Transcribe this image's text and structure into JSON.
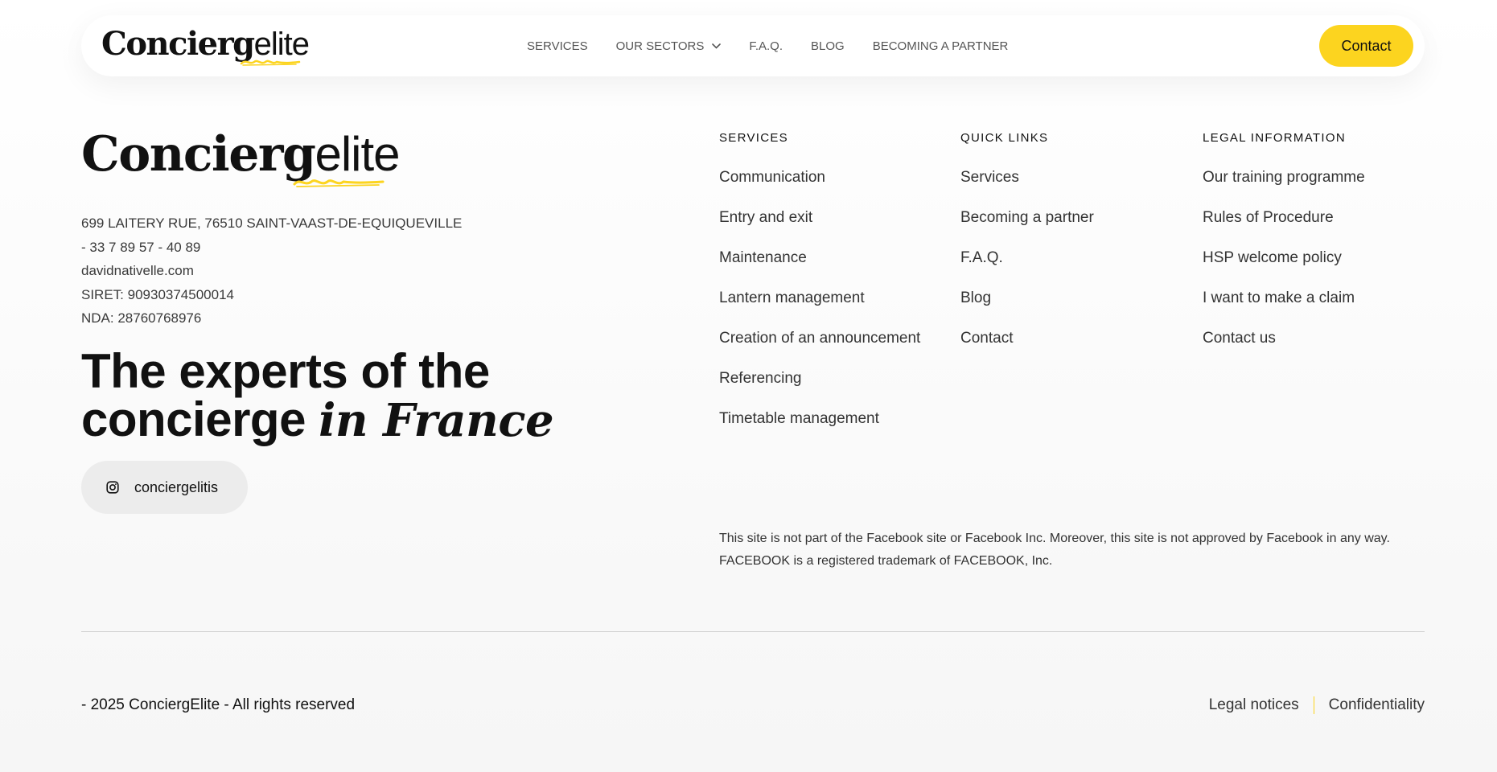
{
  "brand": {
    "logo_bold": "Concierg",
    "logo_light": "elite",
    "accent_color": "#fcd41f"
  },
  "nav": {
    "items": [
      {
        "label": "SERVICES"
      },
      {
        "label": "OUR SECTORS",
        "has_dropdown": true
      },
      {
        "label": "F.A.Q."
      },
      {
        "label": "BLOG"
      },
      {
        "label": "BECOMING A PARTNER"
      }
    ],
    "contact_label": "Contact"
  },
  "company": {
    "address": "699 LAITERY RUE, 76510 SAINT-VAAST-DE-EQUIQUEVILLE",
    "phone": "- 33 7 89 57 - 40 89",
    "website": "davidnativelle.com",
    "siret": "SIRET: 90930374500014",
    "nda": "NDA: 28760768976"
  },
  "tagline": {
    "line1": "The experts of the",
    "line2_plain": "concierge ",
    "line2_emphasis": "in France"
  },
  "social": {
    "instagram_handle": "conciergelitis",
    "icon": "instagram-icon"
  },
  "columns": [
    {
      "title": "SERVICES",
      "links": [
        "Communication",
        "Entry and exit",
        "Maintenance",
        "Lantern management",
        "Creation of an announcement",
        "Referencing",
        "Timetable management"
      ]
    },
    {
      "title": "QUICK LINKS",
      "links": [
        "Services",
        "Becoming a partner",
        "F.A.Q.",
        "Blog",
        "Contact"
      ]
    },
    {
      "title": "LEGAL INFORMATION",
      "links": [
        "Our training programme",
        "Rules of Procedure",
        "HSP welcome policy",
        "I want to make a claim",
        "Contact us"
      ]
    }
  ],
  "disclaimer": {
    "line1": "This site is not part of the Facebook site or Facebook Inc. Moreover, this site is not approved by Facebook in any way.",
    "line2": "FACEBOOK is a registered trademark of FACEBOOK, Inc."
  },
  "bottom": {
    "copyright": "- 2025 ConciergElite - All rights reserved",
    "legal_notices": "Legal notices",
    "confidentiality": "Confidentiality"
  }
}
